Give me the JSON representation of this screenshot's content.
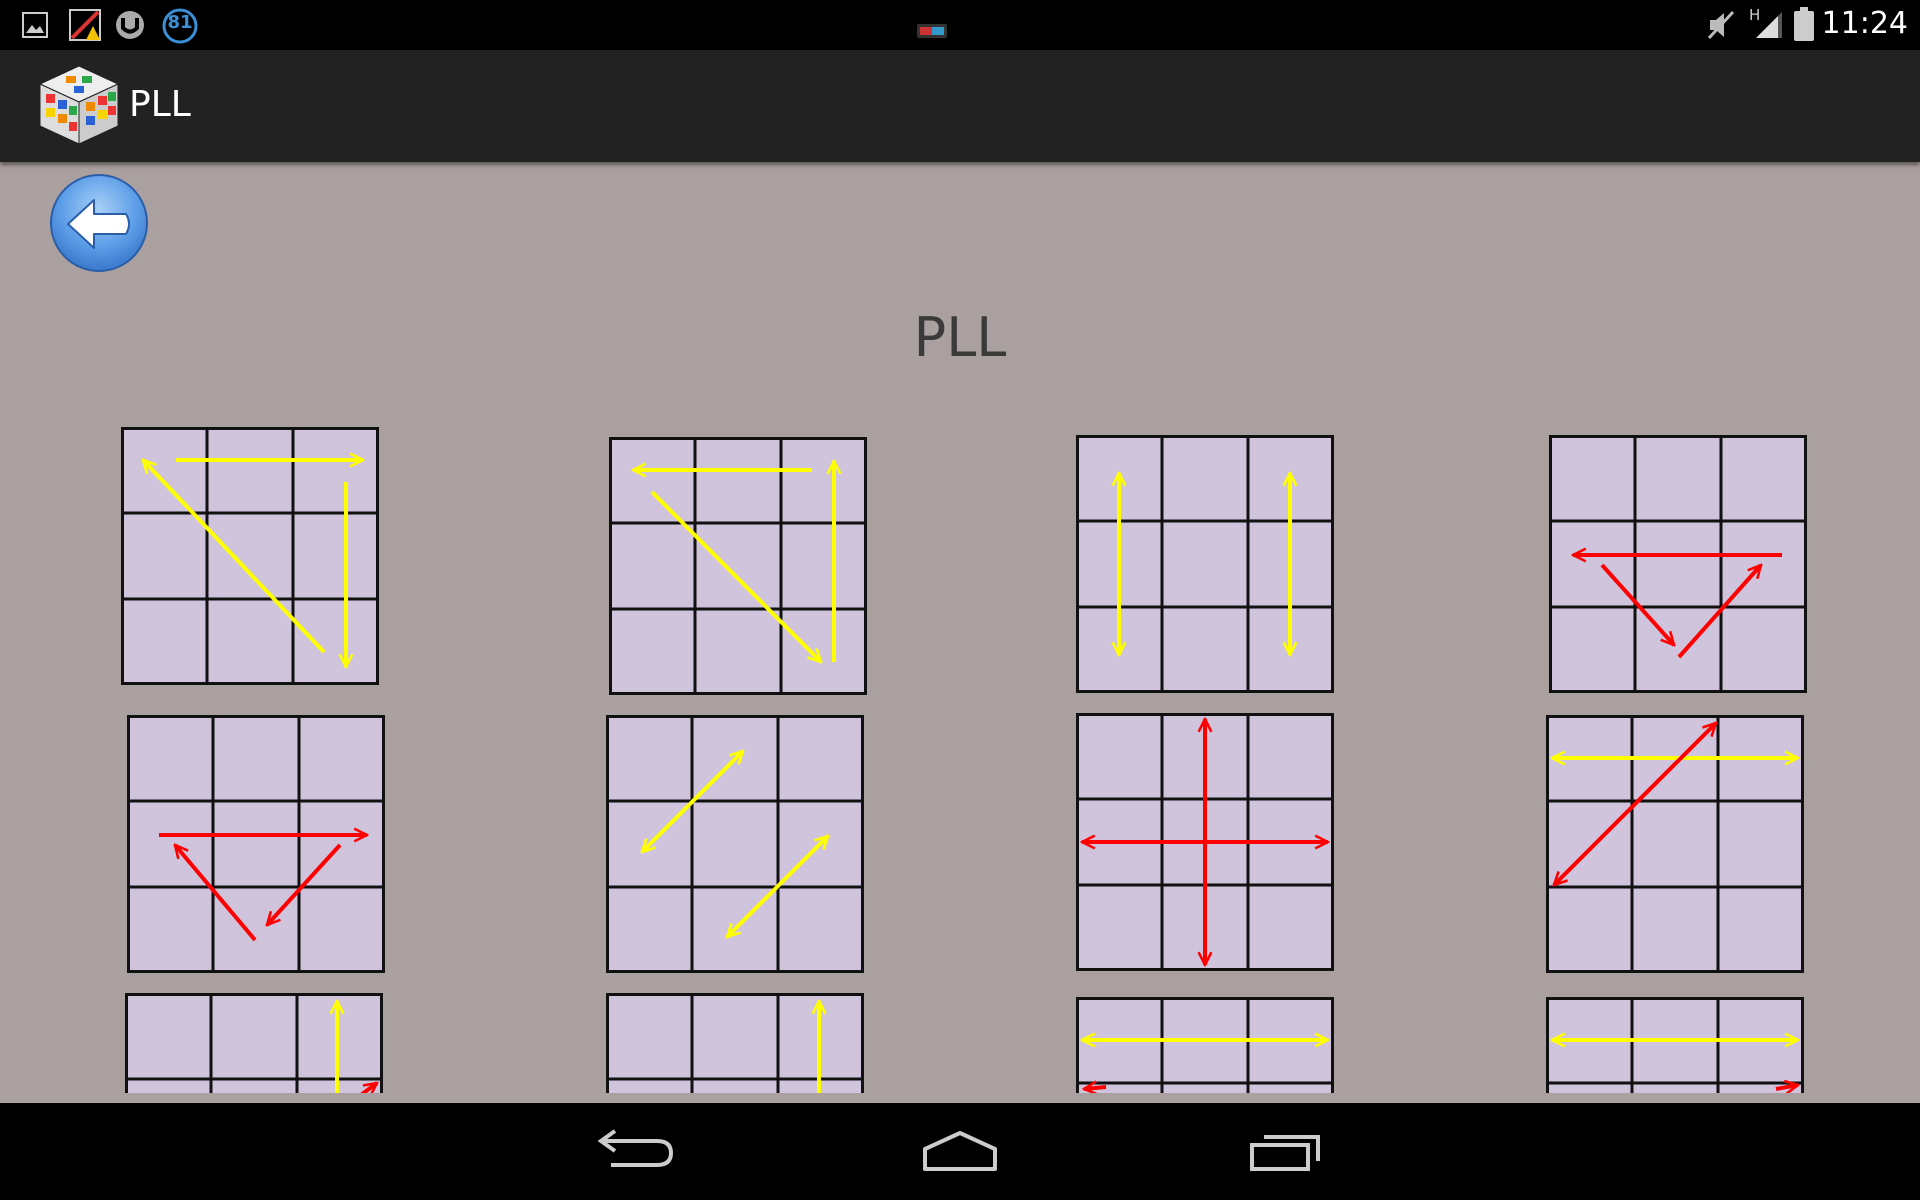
{
  "status_bar": {
    "time": "11:24",
    "notification_badge": "81",
    "network_type": "H",
    "left_icons": [
      "gallery-icon",
      "warning-app-icon",
      "torrent-icon",
      "badge-81-icon"
    ],
    "right_icons": [
      "mute-icon",
      "signal-icon",
      "battery-icon"
    ]
  },
  "action_bar": {
    "title": "PLL",
    "app_icon": "rubiks-cube-icon"
  },
  "content": {
    "back_icon": "back-arrow-icon",
    "title": "PLL"
  },
  "colors": {
    "background": "#aaa09f",
    "tile_fill": "#cfc4dc",
    "grid_line": "#111111",
    "arrow_yellow": "#ffff00",
    "arrow_red": "#ff0000",
    "back_button": "#5d9ee8"
  },
  "navigation_bar": {
    "buttons": [
      "back-nav-icon",
      "home-nav-icon",
      "recents-nav-icon"
    ]
  }
}
